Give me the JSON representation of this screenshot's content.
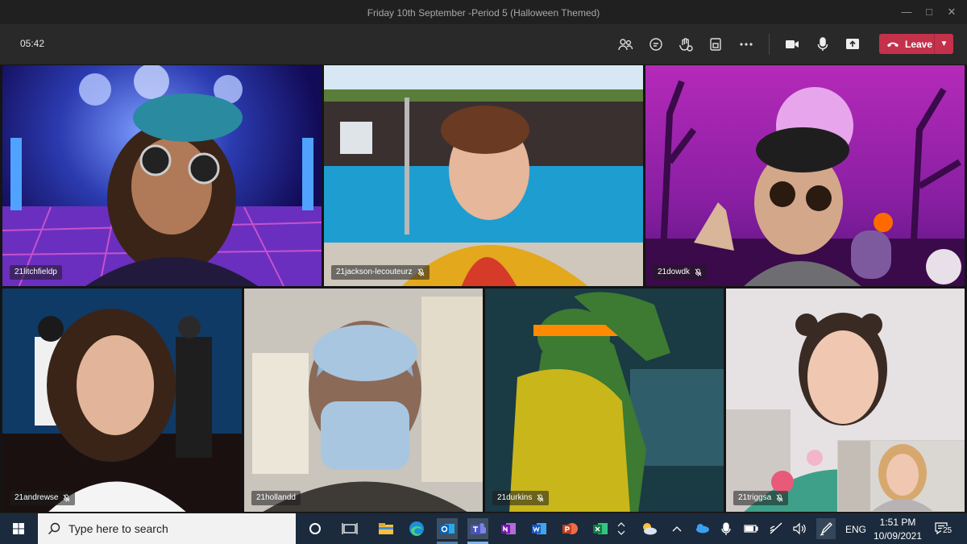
{
  "window": {
    "title": "Friday 10th September -Period 5 (Halloween Themed)"
  },
  "toolbar": {
    "timer": "05:42",
    "leave_label": "Leave",
    "accent": "#c4314b"
  },
  "participants": [
    {
      "name": "21litchfieldp"
    },
    {
      "name": "21jackson-lecouteurz"
    },
    {
      "name": "21dowdk"
    },
    {
      "name": "21andrewse"
    },
    {
      "name": "21hollandd"
    },
    {
      "name": "21durkins"
    },
    {
      "name": "21triggsa"
    }
  ],
  "taskbar": {
    "search_placeholder": "Type here to search",
    "language": "ENG",
    "time": "1:51 PM",
    "date": "10/09/2021",
    "notifications": "25",
    "apps": [
      "file-explorer-icon",
      "edge-icon",
      "outlook-icon",
      "teams-icon",
      "onenote-icon",
      "word-icon",
      "powerpoint-icon",
      "excel-icon"
    ]
  }
}
